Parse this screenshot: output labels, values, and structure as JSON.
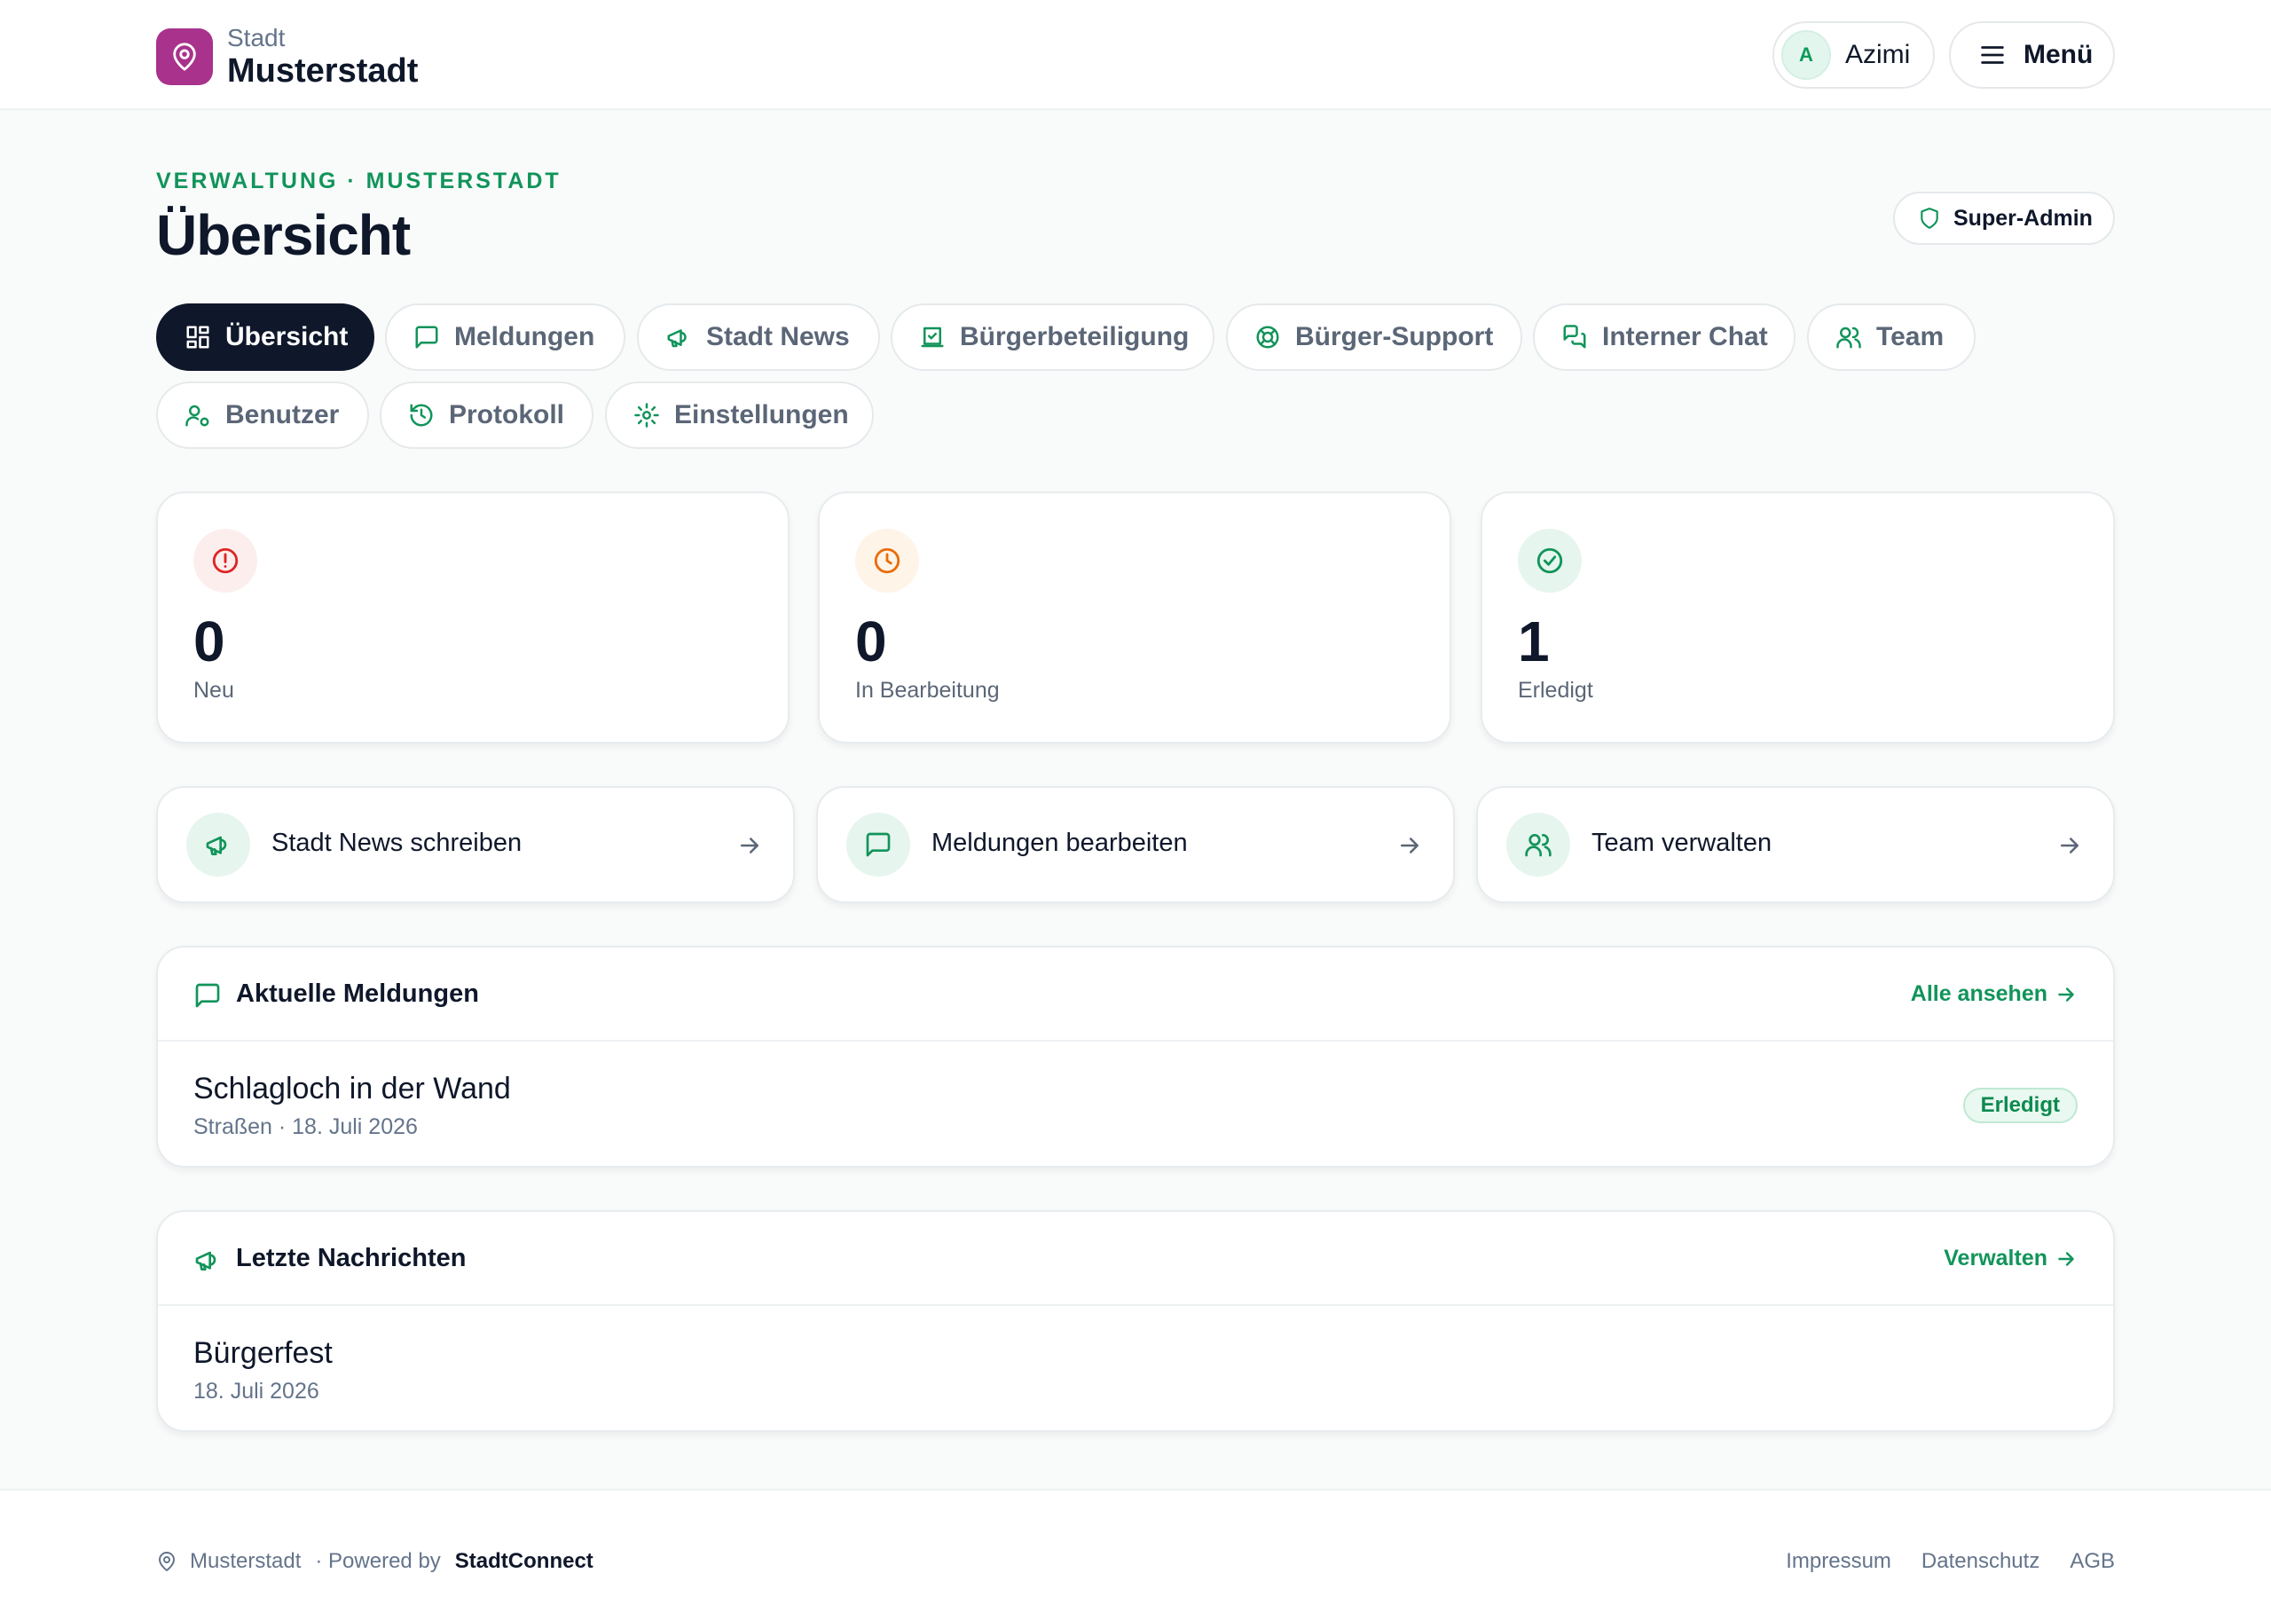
{
  "header": {
    "brand_sub": "Stadt",
    "brand_main": "Musterstadt",
    "user_initial": "A",
    "user_name": "Azimi",
    "menu_label": "Menü"
  },
  "page": {
    "eyebrow": "VERWALTUNG · MUSTERSTADT",
    "title": "Übersicht",
    "role_badge": "Super-Admin"
  },
  "tabs": [
    {
      "label": "Übersicht",
      "icon": "dashboard-icon",
      "active": true
    },
    {
      "label": "Meldungen",
      "icon": "message-icon"
    },
    {
      "label": "Stadt News",
      "icon": "megaphone-icon"
    },
    {
      "label": "Bürgerbeteiligung",
      "icon": "vote-icon"
    },
    {
      "label": "Bürger-Support",
      "icon": "lifebuoy-icon"
    },
    {
      "label": "Interner Chat",
      "icon": "chat-icon"
    },
    {
      "label": "Team",
      "icon": "users-icon"
    },
    {
      "label": "Benutzer",
      "icon": "user-cog-icon"
    },
    {
      "label": "Protokoll",
      "icon": "history-icon"
    },
    {
      "label": "Einstellungen",
      "icon": "gear-icon"
    }
  ],
  "stats": [
    {
      "value": "0",
      "label": "Neu",
      "icon": "alert-circle-icon",
      "color": "#dc2626"
    },
    {
      "value": "0",
      "label": "In Bearbeitung",
      "icon": "clock-icon",
      "color": "#ea6c0a"
    },
    {
      "value": "1",
      "label": "Erledigt",
      "icon": "check-circle-icon",
      "color": "#11945a"
    }
  ],
  "actions": [
    {
      "label": "Stadt News schreiben",
      "icon": "megaphone-icon"
    },
    {
      "label": "Meldungen bearbeiten",
      "icon": "message-icon"
    },
    {
      "label": "Team verwalten",
      "icon": "users-icon"
    }
  ],
  "reports_panel": {
    "title": "Aktuelle Meldungen",
    "link": "Alle ansehen",
    "items": [
      {
        "title": "Schlagloch in der Wand",
        "meta": "Straßen · 18. Juli 2026",
        "status": "Erledigt"
      }
    ]
  },
  "news_panel": {
    "title": "Letzte Nachrichten",
    "link": "Verwalten",
    "items": [
      {
        "title": "Bürgerfest",
        "meta": "18. Juli 2026"
      }
    ]
  },
  "footer": {
    "city": "Musterstadt",
    "powered": "· Powered by",
    "brand": "StadtConnect",
    "links": [
      "Impressum",
      "Datenschutz",
      "AGB"
    ]
  },
  "colors": {
    "accent": "#11945a",
    "brand": "#a8328c",
    "dark": "#0f172a"
  }
}
